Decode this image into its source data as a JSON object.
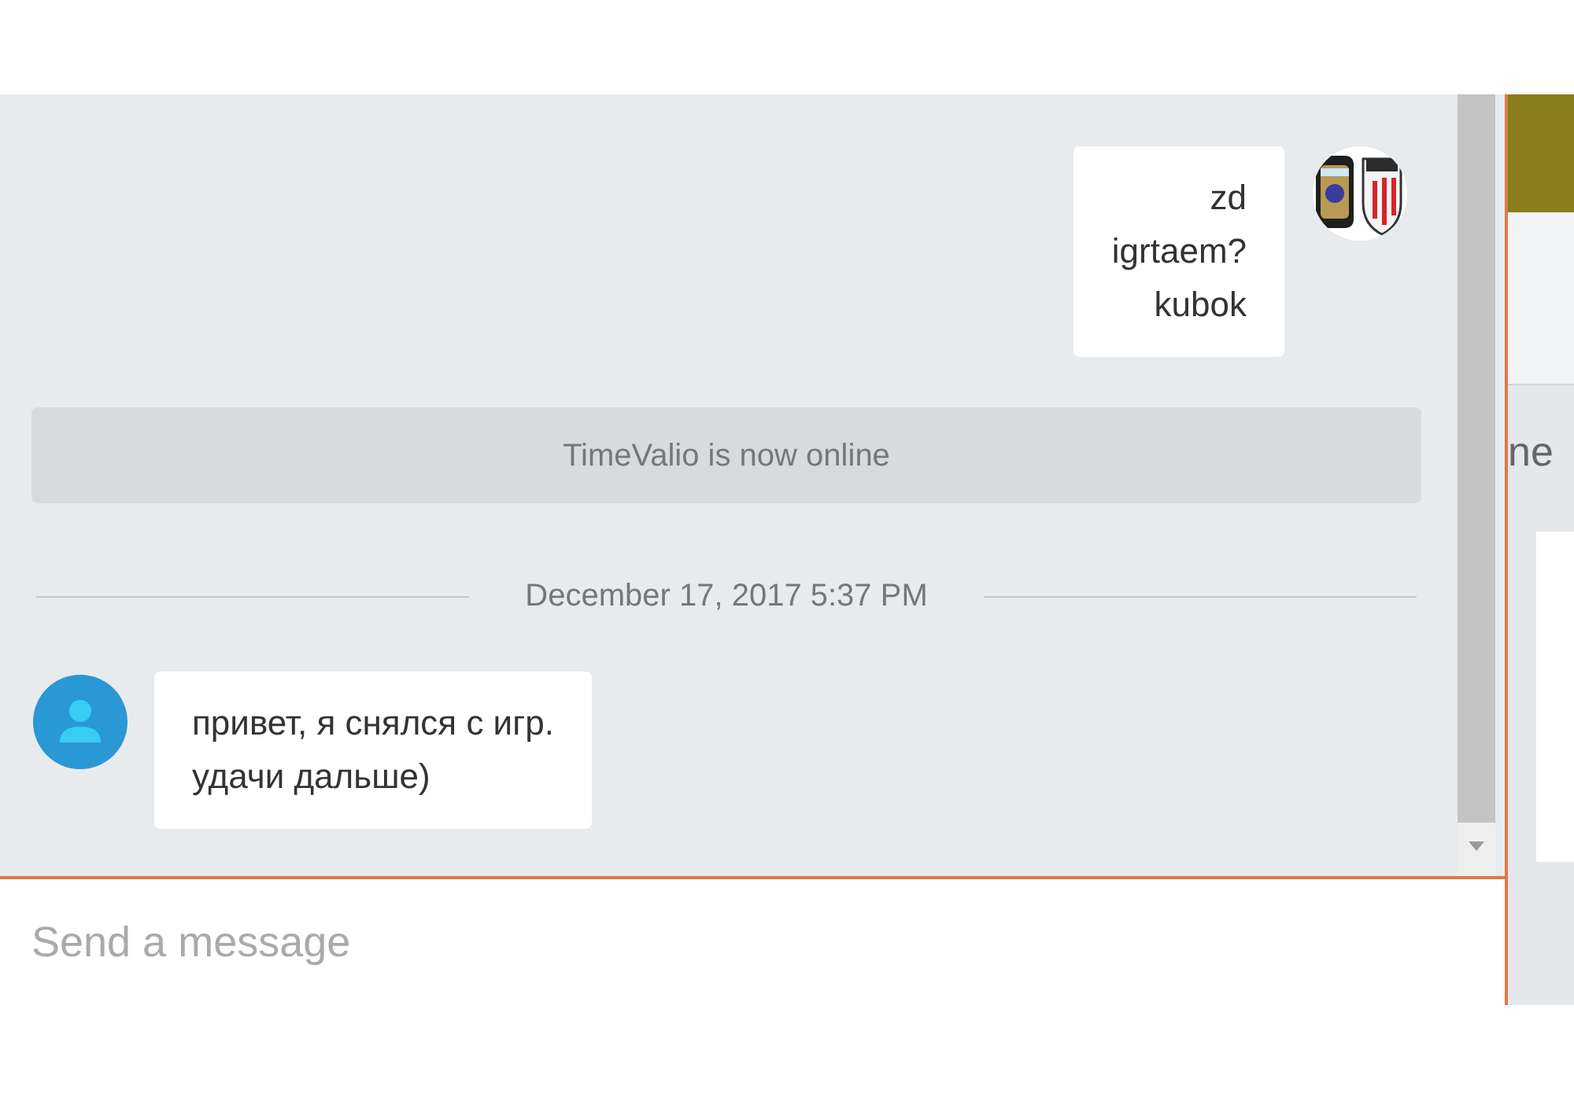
{
  "messages": [
    {
      "kind": "outgoing",
      "lines": [
        "zd",
        "igrtaem?",
        "kubok"
      ],
      "avatar": {
        "kind": "picture"
      }
    },
    {
      "kind": "system",
      "text": "TimeValio is now online"
    },
    {
      "kind": "date",
      "text": "December 17, 2017 5:37 PM"
    },
    {
      "kind": "incoming",
      "lines": [
        "привет, я снялся с игр.",
        "удачи дальше)"
      ]
    }
  ],
  "composer": {
    "placeholder": "Send a message"
  },
  "side_panel": {
    "text": "ne"
  }
}
